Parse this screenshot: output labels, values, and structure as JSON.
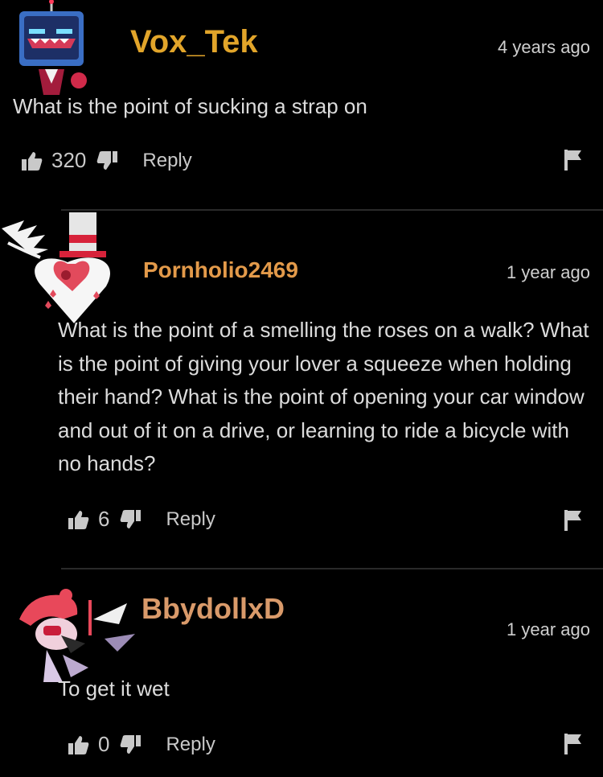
{
  "comments": [
    {
      "username": "Vox_Tek",
      "time": "4 years ago",
      "text": "What is the point of sucking a strap on",
      "likes": "320",
      "reply_label": "Reply",
      "username_color": "#e2a52a"
    },
    {
      "username": "Pornholio2469",
      "time": "1 year ago",
      "text": "What is the point of a smelling the roses on a walk? What is the point of giving your lover a squeeze when holding their hand? What is the point of opening your car window and out of it on a drive, or learning to ride a bicycle with no hands?",
      "likes": "6",
      "reply_label": "Reply",
      "username_color": "#e39a4a"
    },
    {
      "username": "BbydollxD",
      "time": "1 year ago",
      "text": "To get it wet",
      "likes": "0",
      "reply_label": "Reply",
      "username_color": "#d99a6a"
    }
  ],
  "icons": {
    "like": "thumbs-up-icon",
    "dislike": "thumbs-down-icon",
    "flag": "flag-icon"
  }
}
